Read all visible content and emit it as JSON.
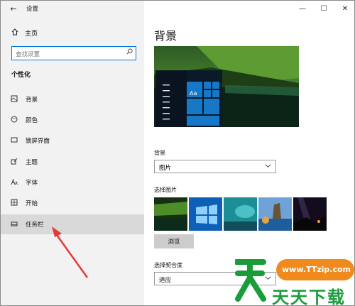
{
  "titlebar": {
    "back_icon": "←",
    "title": "设置"
  },
  "window_controls": {
    "minimize": "—",
    "maximize": "☐",
    "close": "✕"
  },
  "sidebar": {
    "home_icon": "home-icon",
    "home_label": "主页",
    "search_placeholder": "查找设置",
    "section_title": "个性化",
    "items": [
      {
        "label": "背景",
        "icon": "image-icon",
        "glyph": "▣"
      },
      {
        "label": "颜色",
        "icon": "palette-icon",
        "glyph": "◎"
      },
      {
        "label": "锁屏界面",
        "icon": "lock-screen-icon",
        "glyph": "▭"
      },
      {
        "label": "主题",
        "icon": "theme-icon",
        "glyph": "✎"
      },
      {
        "label": "字体",
        "icon": "font-icon",
        "glyph": "A"
      },
      {
        "label": "开始",
        "icon": "start-icon",
        "glyph": "▦"
      },
      {
        "label": "任务栏",
        "icon": "taskbar-icon",
        "glyph": "▭",
        "active": true
      }
    ]
  },
  "main": {
    "page_title": "背景",
    "preview_tile_label": "Aa",
    "background_label": "背景",
    "background_value": "图片",
    "choose_picture_label": "选择图片",
    "browse_label": "浏览",
    "fit_label": "选择契合度",
    "fit_value": "适应"
  },
  "watermark": {
    "url": "www.TTzip.com",
    "brand": "天天下载"
  },
  "colors": {
    "accent": "#0078d7",
    "arrow": "#e53935",
    "watermark_green": "#1a9c3a",
    "watermark_orange": "#f08a1c"
  }
}
